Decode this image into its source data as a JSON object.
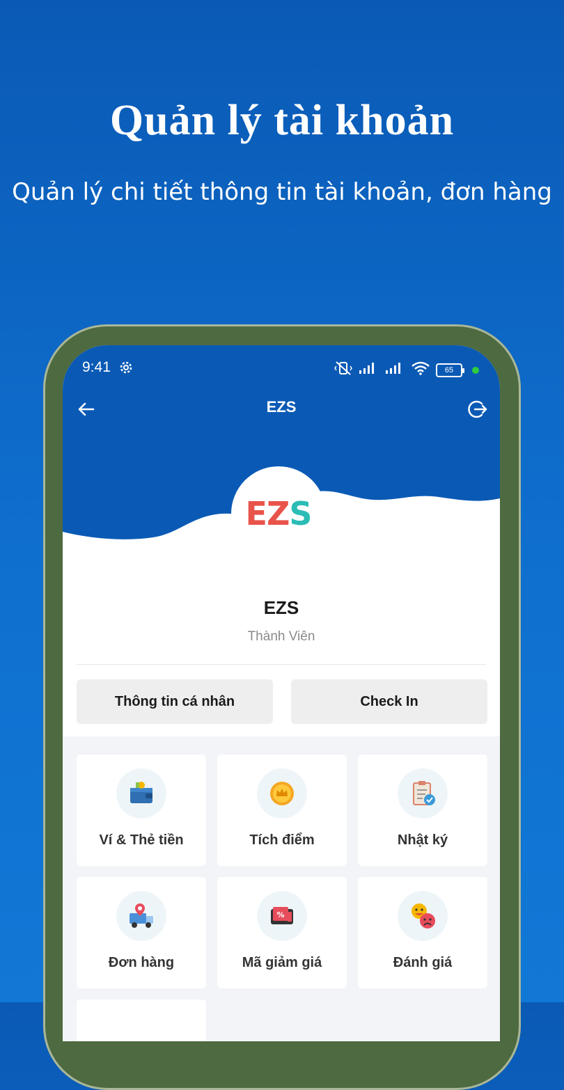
{
  "promo": {
    "title": "Quản lý tài khoản",
    "subtitle": "Quản lý chi tiết thông tin tài khoản, đơn hàng"
  },
  "status_bar": {
    "time": "9:41",
    "battery": "65"
  },
  "nav": {
    "title": "EZS",
    "back_icon": "arrow-left-icon",
    "logout_icon": "logout-icon"
  },
  "profile": {
    "logo": {
      "e": "E",
      "z": "Z",
      "s": "S"
    },
    "name": "EZS",
    "role": "Thành Viên"
  },
  "actions": {
    "personal_info": "Thông tin cá nhân",
    "check_in": "Check In"
  },
  "menu": [
    {
      "label": "Ví & Thẻ tiền",
      "icon": "wallet-icon"
    },
    {
      "label": "Tích điểm",
      "icon": "coin-icon"
    },
    {
      "label": "Nhật ký",
      "icon": "clipboard-icon"
    },
    {
      "label": "Đơn hàng",
      "icon": "delivery-truck-icon"
    },
    {
      "label": "Mã giảm giá",
      "icon": "voucher-icon"
    },
    {
      "label": "Đánh giá",
      "icon": "emoji-rating-icon"
    }
  ],
  "colors": {
    "brand_blue": "#0a5ab5",
    "logo_red": "#e8534a",
    "logo_teal": "#2bbcb5",
    "frame_green": "#4e6a40"
  }
}
